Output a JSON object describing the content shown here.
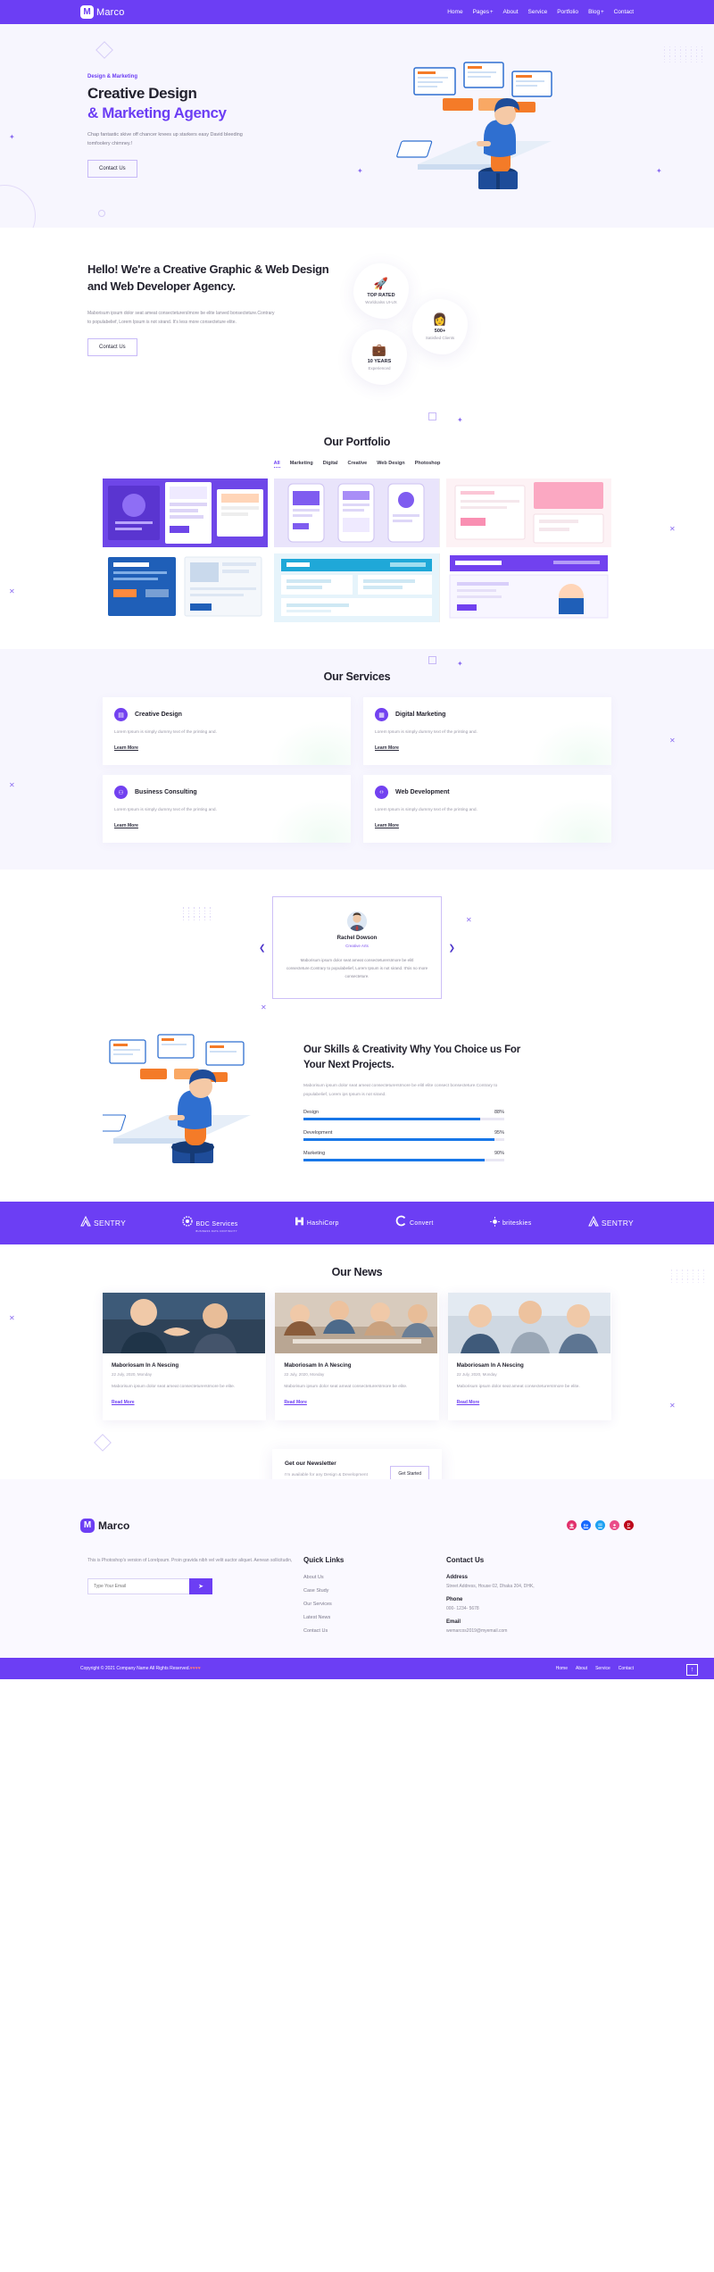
{
  "header": {
    "brand": {
      "mark": "M",
      "name": "Marco"
    },
    "nav": [
      {
        "label": "Home",
        "plus": false
      },
      {
        "label": "Pages",
        "plus": true
      },
      {
        "label": "About",
        "plus": false
      },
      {
        "label": "Service",
        "plus": false
      },
      {
        "label": "Portfolio",
        "plus": false
      },
      {
        "label": "Blog",
        "plus": true
      },
      {
        "label": "Contact",
        "plus": false
      }
    ]
  },
  "hero": {
    "eyebrow": "Design & Marketing",
    "title_line1": "Creative Design",
    "title_line2": "& Marketing Agency",
    "paragraph": "Chap fantastic skive off chancer knees up starkers easy David bleeding tomfoolery chimney.!",
    "cta": "Contact Us"
  },
  "about": {
    "heading": "Hello! We're a Creative Graphic & Web Design and Web Developer Agency.",
    "paragraph": "Maborisum ipsum dolor seat ameat consecteturersImore be elite lanved bonsecteture.Contrary to populabelief, Lorem Ipsum is not sirand. It's less more consecteture elite.",
    "cta": "Contact Us",
    "badges": [
      {
        "icon": "rocket-icon",
        "glyph": "🚀",
        "title": "TOP RATED",
        "subtitle": "Worldcalss UI-UX"
      },
      {
        "icon": "client-icon",
        "glyph": "👩",
        "title": "500+",
        "subtitle": "Satisfied Clients"
      },
      {
        "icon": "briefcase-icon",
        "glyph": "💼",
        "title": "10 YEARS",
        "subtitle": "Experienced"
      }
    ]
  },
  "portfolio": {
    "title": "Our Portfolio",
    "filters": [
      "All",
      "Marketing",
      "Digital",
      "Creative",
      "Web Design",
      "Photoshop"
    ],
    "active_filter": "All",
    "items": [
      {
        "name": "portfolio-item-1",
        "theme": "purple-devices"
      },
      {
        "name": "portfolio-item-2",
        "theme": "violet-phones"
      },
      {
        "name": "portfolio-item-3",
        "theme": "pink-mockup"
      },
      {
        "name": "portfolio-item-4",
        "theme": "blue-dashboard"
      },
      {
        "name": "portfolio-item-5",
        "theme": "cyan-website"
      },
      {
        "name": "portfolio-item-6",
        "theme": "purple-banner"
      }
    ]
  },
  "services": {
    "title": "Our Services",
    "items": [
      {
        "icon": "layout-icon",
        "glyph": "▤",
        "title": "Creative Design",
        "text": "Lorem Ipsum is simply dummy text ef the printing and.",
        "link": "Learn More"
      },
      {
        "icon": "megaphone-icon",
        "glyph": "▦",
        "title": "Digital Marketing",
        "text": "Lorem Ipsum is simply dummy text ef the printing and.",
        "link": "Learn More"
      },
      {
        "icon": "people-icon",
        "glyph": "⚇",
        "title": "Business Consulting",
        "text": "Lorem Ipsum is simply dummy text ef the printing and.",
        "link": "Learn More"
      },
      {
        "icon": "code-icon",
        "glyph": "‹›",
        "title": "Web Development",
        "text": "Lorem Ipsum is simply dummy text ef the printing and.",
        "link": "Learn More"
      }
    ]
  },
  "testimonial": {
    "name": "Rachel Dowson",
    "role": "Creative Arts",
    "quote": "Maborisum ipsum dolor seat ameat consecteturersImore be elitl consecteture.Contrary to populabelief, Lorem Ipsum is not sirand. It'sis no more consecteture.",
    "prev_icon": "chevron-left-icon",
    "next_icon": "chevron-right-icon"
  },
  "skills": {
    "heading": "Our Skills & Creativity Why You Choice us For Your Next Projects.",
    "paragraph": "Maborisum ipsum dolor seat ameat consecteturersImore be elitl elite consect bonsecteture.Contrary to populabelief, Lorem ips Ipsum is not sirand.",
    "bars": [
      {
        "label": "Design",
        "value": 88,
        "display": "88%"
      },
      {
        "label": "Development",
        "value": 95,
        "display": "95%"
      },
      {
        "label": "Marketing",
        "value": 90,
        "display": "90%"
      }
    ]
  },
  "brands": [
    {
      "name": "SENTRY",
      "icon": "sentry-icon",
      "sub": ""
    },
    {
      "name": "BDC Services",
      "icon": "bdc-icon",
      "sub": "BUSINESS DATA CONTINUITY"
    },
    {
      "name": "HashiCorp",
      "icon": "hashicorp-icon",
      "sub": ""
    },
    {
      "name": "Convert",
      "icon": "convert-icon",
      "sub": ""
    },
    {
      "name": "briteskies",
      "icon": "briteskies-icon",
      "sub": ""
    },
    {
      "name": "SENTRY",
      "icon": "sentry-icon",
      "sub": ""
    }
  ],
  "news": {
    "title": "Our News",
    "items": [
      {
        "title": "Maboriosam In A Nescing",
        "date": "22 July, 2020, Monday",
        "text": "Maborisum ipsum dolor seat ameat consecteturersImore be elite.",
        "link": "Read More",
        "theme": "handshake"
      },
      {
        "title": "Maboriosam In A Nescing",
        "date": "22 July, 2020, Monday",
        "text": "Maborisum ipsum dolor seat ameat consecteturersImore be elite.",
        "link": "Read More",
        "theme": "team-meeting"
      },
      {
        "title": "Maboriosam In A Nescing",
        "date": "22 July, 2020, Monday",
        "text": "Maborisum ipsum dolor seat ameat consecteturersImore be elite.",
        "link": "Read More",
        "theme": "office-group"
      }
    ]
  },
  "newsletter": {
    "title": "Get our Newsletter",
    "text": "I'm available for any Design & Development freelance projects.",
    "button": "Get Started"
  },
  "footer": {
    "brand": {
      "mark": "M",
      "name": "Marco"
    },
    "socials": [
      {
        "name": "instagram-icon",
        "glyph": "◉",
        "color": "#e1306c"
      },
      {
        "name": "behance-icon",
        "glyph": "Be",
        "color": "#1769ff"
      },
      {
        "name": "twitter-icon",
        "glyph": "✉",
        "color": "#1da1f2"
      },
      {
        "name": "dribbble-icon",
        "glyph": "●",
        "color": "#ea4c89"
      },
      {
        "name": "pinterest-icon",
        "glyph": "P",
        "color": "#bd081c"
      }
    ],
    "description": "This is Photoshop's version of LoreIpsum. Proin gravida nibh vel velit auctor aliquet. Aenean sollicitudin,",
    "email_placeholder": "Type Your Email",
    "send_icon": "send-icon",
    "quick_links": {
      "heading": "Quick Links",
      "items": [
        "About Us",
        "Case Study",
        "Our Services",
        "Latest News",
        "Contact Us"
      ]
    },
    "contact": {
      "heading": "Contact Us",
      "address_label": "Address",
      "address_value": "Street Address, House 02, Dhaka 204, DHK,",
      "phone_label": "Phone",
      "phone_value": "000- 1234- 5678",
      "email_label": "Email",
      "email_value": "wemarcos2019@myemail.com"
    },
    "copyright": "Copyright © 2021 Company Name All Rights Reserved.",
    "copyright_highlight": "♥♥♥♥",
    "bottom_nav": [
      "Home",
      "About",
      "Service",
      "Contact"
    ],
    "to_top_icon": "arrow-up-icon"
  },
  "colors": {
    "brand_purple": "#6c3ef4",
    "accent_blue": "#1877e8",
    "hero_bg": "#f7f6fe"
  }
}
